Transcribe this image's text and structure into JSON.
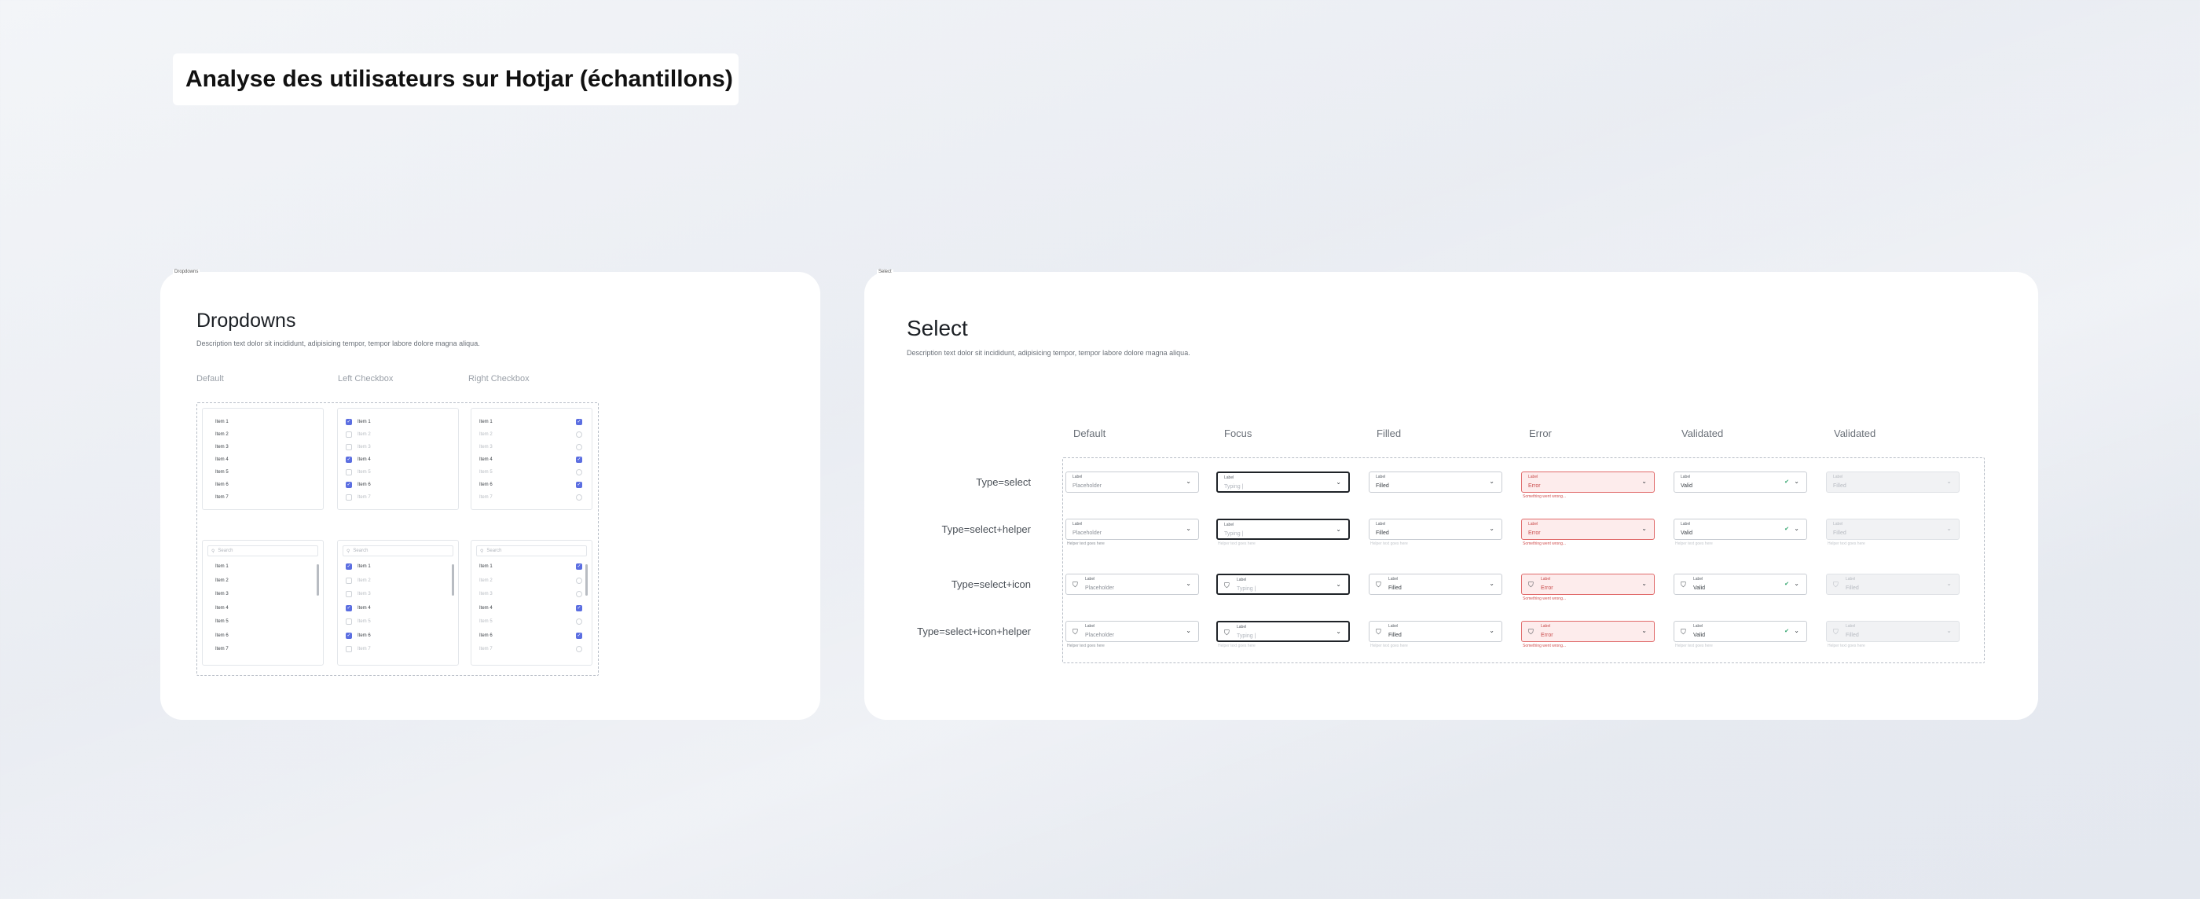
{
  "page_title": "Analyse des utilisateurs sur Hotjar (échantillons)",
  "dropdowns": {
    "frame_tag": "Dropdowns",
    "title": "Dropdowns",
    "description": "Description text dolor sit incididunt, adipisicing tempor, tempor labore dolore magna aliqua.",
    "columns": [
      "Default",
      "Left Checkbox",
      "Right Checkbox"
    ],
    "items": [
      "Item 1",
      "Item 2",
      "Item 3",
      "Item 4",
      "Item 5",
      "Item 6",
      "Item 7"
    ],
    "search_placeholder": "Search",
    "checked_indices": [
      0,
      3,
      5
    ],
    "search_checked_indices": [
      0,
      3,
      5
    ]
  },
  "select": {
    "frame_tag": "Select",
    "title": "Select",
    "description": "Description text dolor sit incididunt, adipisicing tempor, tempor labore dolore magna aliqua.",
    "columns": [
      "Default",
      "Focus",
      "Filled",
      "Error",
      "Validated",
      "Validated"
    ],
    "rows": [
      "Type=select",
      "Type=select+helper",
      "Type=select+icon",
      "Type=select+icon+helper"
    ],
    "field_label": "Label",
    "values": {
      "default": "Placeholder",
      "focus": "Typing |",
      "filled": "Filled",
      "error": "Error",
      "validated": "Valid",
      "disabled": "Filled"
    },
    "helper_text": "Helper text goes here",
    "error_text": "Something went wrong..."
  },
  "colors": {
    "accent_checkbox": "#5b6ee1",
    "error": "#e06a6a",
    "valid": "#5cc08a"
  }
}
